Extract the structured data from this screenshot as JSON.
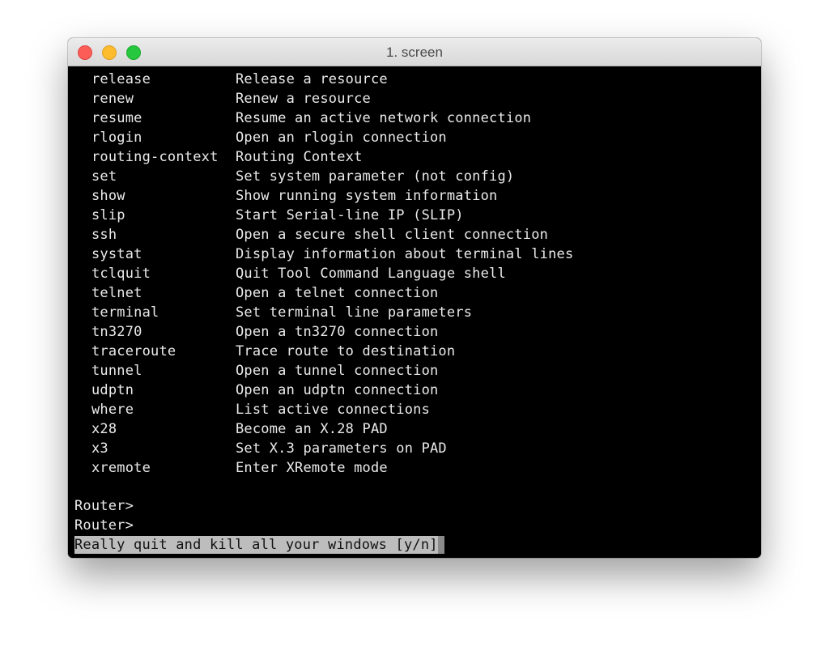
{
  "window": {
    "title": "1. screen"
  },
  "commands": [
    {
      "name": "release",
      "desc": "Release a resource"
    },
    {
      "name": "renew",
      "desc": "Renew a resource"
    },
    {
      "name": "resume",
      "desc": "Resume an active network connection"
    },
    {
      "name": "rlogin",
      "desc": "Open an rlogin connection"
    },
    {
      "name": "routing-context",
      "desc": "Routing Context"
    },
    {
      "name": "set",
      "desc": "Set system parameter (not config)"
    },
    {
      "name": "show",
      "desc": "Show running system information"
    },
    {
      "name": "slip",
      "desc": "Start Serial-line IP (SLIP)"
    },
    {
      "name": "ssh",
      "desc": "Open a secure shell client connection"
    },
    {
      "name": "systat",
      "desc": "Display information about terminal lines"
    },
    {
      "name": "tclquit",
      "desc": "Quit Tool Command Language shell"
    },
    {
      "name": "telnet",
      "desc": "Open a telnet connection"
    },
    {
      "name": "terminal",
      "desc": "Set terminal line parameters"
    },
    {
      "name": "tn3270",
      "desc": "Open a tn3270 connection"
    },
    {
      "name": "traceroute",
      "desc": "Trace route to destination"
    },
    {
      "name": "tunnel",
      "desc": "Open a tunnel connection"
    },
    {
      "name": "udptn",
      "desc": "Open an udptn connection"
    },
    {
      "name": "where",
      "desc": "List active connections"
    },
    {
      "name": "x28",
      "desc": "Become an X.28 PAD"
    },
    {
      "name": "x3",
      "desc": "Set X.3 parameters on PAD"
    },
    {
      "name": "xremote",
      "desc": "Enter XRemote mode"
    }
  ],
  "prompts": [
    "Router>",
    "Router>"
  ],
  "quit_message": "Really quit and kill all your windows [y/n]",
  "colors": {
    "terminal_bg": "#000000",
    "terminal_fg": "#eaeaea",
    "highlight_bg": "#bdbdbd",
    "close": "#fc5e57",
    "minimize": "#fdbc2e",
    "maximize": "#27c83f"
  }
}
